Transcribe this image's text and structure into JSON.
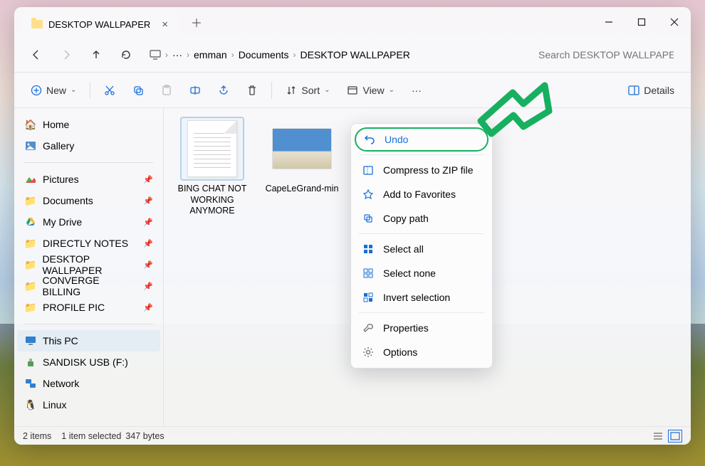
{
  "tab_title": "DESKTOP WALLPAPER",
  "breadcrumb": [
    "emman",
    "Documents",
    "DESKTOP WALLPAPER"
  ],
  "search_placeholder": "Search DESKTOP WALLPAPER",
  "toolbar": {
    "new": "New",
    "sort": "Sort",
    "view": "View",
    "details": "Details"
  },
  "sidebar": {
    "home": "Home",
    "gallery": "Gallery",
    "quick": [
      {
        "label": "Pictures",
        "icon": "pictures"
      },
      {
        "label": "Documents",
        "icon": "folder"
      },
      {
        "label": "My Drive",
        "icon": "gdrive"
      },
      {
        "label": "DIRECTLY NOTES",
        "icon": "folder"
      },
      {
        "label": "DESKTOP WALLPAPER",
        "icon": "folder"
      },
      {
        "label": "CONVERGE BILLING",
        "icon": "folder"
      },
      {
        "label": "PROFILE PIC",
        "icon": "folder"
      }
    ],
    "thispc": "This PC",
    "drives": [
      {
        "label": "SANDISK USB (F:)",
        "icon": "usb"
      },
      {
        "label": "Network",
        "icon": "network"
      },
      {
        "label": "Linux",
        "icon": "linux"
      }
    ]
  },
  "files": [
    {
      "name": "BING CHAT NOT WORKING ANYMORE",
      "type": "text",
      "selected": true
    },
    {
      "name": "CapeLeGrand-min",
      "type": "image",
      "selected": false
    }
  ],
  "context_menu": {
    "undo": "Undo",
    "compress": "Compress to ZIP file",
    "favorites": "Add to Favorites",
    "copypath": "Copy path",
    "selectall": "Select all",
    "selectnone": "Select none",
    "invert": "Invert selection",
    "properties": "Properties",
    "options": "Options"
  },
  "status": {
    "items": "2 items",
    "selected": "1 item selected",
    "size": "347 bytes"
  }
}
